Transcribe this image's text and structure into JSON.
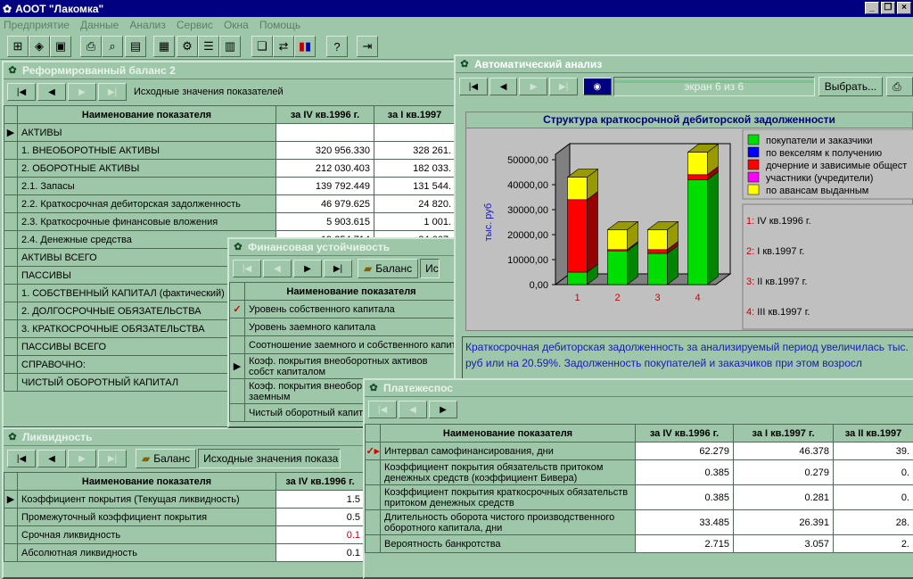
{
  "app": {
    "title": "АООТ \"Лакомка\""
  },
  "menu": [
    "Предприятие",
    "Данные",
    "Анализ",
    "Сервис",
    "Окна",
    "Помощь"
  ],
  "balance": {
    "title": "Реформированный баланс 2",
    "mode": "Исходные значения показателей",
    "headers": [
      "Наименование показателя",
      "за IV кв.1996 г.",
      "за I кв.1997"
    ],
    "rows": [
      [
        "АКТИВЫ",
        "",
        ""
      ],
      [
        "1. ВНЕОБОРОТНЫЕ АКТИВЫ",
        "320 956.330",
        "328 261."
      ],
      [
        "2. ОБОРОТНЫЕ АКТИВЫ",
        "212 030.403",
        "182 033."
      ],
      [
        "2.1. Запасы",
        "139 792.449",
        "131 544."
      ],
      [
        "2.2. Краткосрочная дебиторская задолженность",
        "46 979.625",
        "24 820."
      ],
      [
        "2.3. Краткосрочные финансовые вложения",
        "5 903.615",
        "1 001."
      ],
      [
        "2.4. Денежные средства",
        "19 354.714",
        "24 667."
      ],
      [
        "АКТИВЫ ВСЕГО",
        "",
        ""
      ],
      [
        "ПАССИВЫ",
        "",
        ""
      ],
      [
        "1. СОБСТВЕННЫЙ КАПИТАЛ (фактический)",
        "",
        ""
      ],
      [
        "2. ДОЛГОСРОЧНЫЕ ОБЯЗАТЕЛЬСТВА",
        "",
        ""
      ],
      [
        "3. КРАТКОСРОЧНЫЕ ОБЯЗАТЕЛЬСТВА",
        "",
        ""
      ],
      [
        "ПАССИВЫ ВСЕГО",
        "",
        ""
      ],
      [
        "СПРАВОЧНО:",
        "",
        ""
      ],
      [
        "ЧИСТЫЙ ОБОРОТНЫЙ КАПИТАЛ",
        "",
        ""
      ]
    ]
  },
  "finstab": {
    "title": "Финансовая устойчивость",
    "balance_btn": "Баланс",
    "mode": "Ис",
    "header": "Наименование показателя",
    "rows": [
      "Уровень собственного капитала",
      "Уровень заемного капитала",
      "Соотношение заемного и собственного капит",
      "Коэф. покрытия внеоборотных активов собст капиталом",
      "Коэф. покрытия внеобор долгосрочным заемным",
      "Чистый оборотный капит"
    ]
  },
  "liquidity": {
    "title": "Ликвидность",
    "balance_btn": "Баланс",
    "mode": "Исходные значения показа",
    "headers": [
      "Наименование показателя",
      "за IV кв.1996 г."
    ],
    "rows": [
      [
        "Коэффициент покрытия (Текущая ликвидность)",
        "1.5"
      ],
      [
        "Промежуточный коэффициент покрытия",
        "0.5"
      ],
      [
        "Срочная ликвидность",
        "0.1"
      ],
      [
        "Абсолютная ликвидность",
        "0.1"
      ]
    ]
  },
  "payment": {
    "title": "Платежеспос",
    "headers": [
      "Наименование показателя",
      "за IV кв.1996 г.",
      "за I кв.1997 г.",
      "за II кв.1997"
    ],
    "rows": [
      [
        "Интервал самофинансирования, дни",
        "62.279",
        "46.378",
        "39."
      ],
      [
        "Коэффициент покрытия обязательств притоком денежных средств (коэффициент Бивера)",
        "0.385",
        "0.279",
        "0."
      ],
      [
        "Коэффициент покрытия краткосрочных обязательств притоком денежных средств",
        "0.385",
        "0.281",
        "0."
      ],
      [
        "Длительность оборота чистого производственного оборотного капитала, дни",
        "33.485",
        "26.391",
        "28."
      ],
      [
        "Вероятность банкротства",
        "2.715",
        "3.057",
        "2."
      ]
    ]
  },
  "analysis": {
    "title": "Автоматический анализ",
    "screen": "экран 6 из 6",
    "choose_btn": "Выбрать...",
    "text": "Краткосрочная дебиторская задолженность за анализируемый период увеличилась тыс. руб или на 20.59%. Задолженность покупателей и заказчиков при этом возросл"
  },
  "chart_data": {
    "type": "bar",
    "title": "Структура краткосрочной дебиторской задолженности",
    "ylabel": "тыс. руб",
    "ylim": [
      0,
      50000
    ],
    "yticks": [
      "50000,00",
      "40000,00",
      "30000,00",
      "20000,00",
      "10000,00",
      "0,00"
    ],
    "categories": [
      "1",
      "2",
      "3",
      "4"
    ],
    "category_labels": [
      "1: IV кв.1996 г.",
      "2: I кв.1997 г.",
      "3: II кв.1997 г.",
      "4: III кв.1997 г."
    ],
    "series": [
      {
        "name": "покупатели и заказчики",
        "color": "#00dd00",
        "values": [
          5000,
          13500,
          12500,
          42000
        ]
      },
      {
        "name": "по векселям к получению",
        "color": "#0000ff",
        "values": [
          0,
          0,
          0,
          0
        ]
      },
      {
        "name": "дочерние и зависимые общест",
        "color": "#ff0000",
        "values": [
          29000,
          500,
          1500,
          2000
        ]
      },
      {
        "name": "участники (учредители)",
        "color": "#ff00ff",
        "values": [
          0,
          0,
          0,
          0
        ]
      },
      {
        "name": "по авансам выданным",
        "color": "#ffff00",
        "values": [
          9000,
          8000,
          8000,
          9000
        ]
      }
    ]
  }
}
